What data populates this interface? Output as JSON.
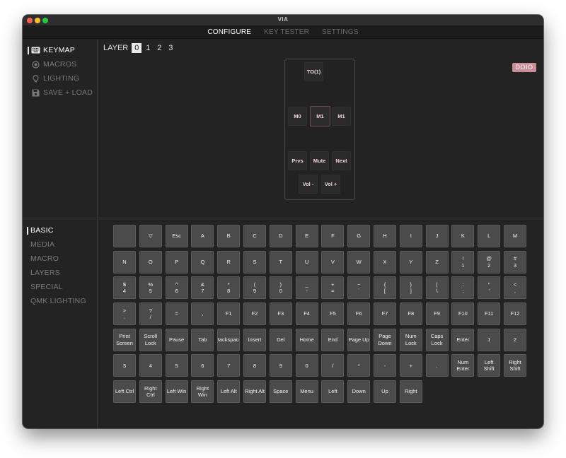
{
  "window": {
    "title": "VIA"
  },
  "topnav": {
    "tabs": [
      {
        "label": "CONFIGURE",
        "active": true
      },
      {
        "label": "KEY TESTER",
        "active": false
      },
      {
        "label": "SETTINGS",
        "active": false
      }
    ]
  },
  "sidebar_top": {
    "items": [
      {
        "label": "KEYMAP",
        "icon": "keyboard-icon",
        "active": true
      },
      {
        "label": "MACROS",
        "icon": "record-icon",
        "active": false
      },
      {
        "label": "LIGHTING",
        "icon": "lightbulb-icon",
        "active": false
      },
      {
        "label": "SAVE + LOAD",
        "icon": "floppy-disk-icon",
        "active": false
      }
    ]
  },
  "layers": {
    "label": "LAYER",
    "options": [
      "0",
      "1",
      "2",
      "3"
    ],
    "selected": "0"
  },
  "device": {
    "badge": "DOIO",
    "keys": {
      "to1": "TO(1)",
      "m0": "M0",
      "m1_center": "M1",
      "m1_right": "M1",
      "prvs": "Prvs",
      "mute": "Mute",
      "next": "Next",
      "vol_down": "Vol -",
      "vol_up": "Vol +"
    },
    "selected_key": "m1_center",
    "accent_color": "#c98d97"
  },
  "sidebar_bottom": {
    "items": [
      {
        "label": "BASIC",
        "active": true
      },
      {
        "label": "MEDIA",
        "active": false
      },
      {
        "label": "MACRO",
        "active": false
      },
      {
        "label": "LAYERS",
        "active": false
      },
      {
        "label": "SPECIAL",
        "active": false
      },
      {
        "label": "QMK LIGHTING",
        "active": false
      }
    ]
  },
  "basic_keys": [
    [
      ""
    ],
    [
      "▽"
    ],
    [
      "Esc"
    ],
    [
      "A"
    ],
    [
      "B"
    ],
    [
      "C"
    ],
    [
      "D"
    ],
    [
      "E"
    ],
    [
      "F"
    ],
    [
      "G"
    ],
    [
      "H"
    ],
    [
      "I"
    ],
    [
      "J"
    ],
    [
      "K"
    ],
    [
      "L"
    ],
    [
      "M"
    ],
    [
      "N"
    ],
    [
      "O"
    ],
    [
      "P"
    ],
    [
      "Q"
    ],
    [
      "R"
    ],
    [
      "S"
    ],
    [
      "T"
    ],
    [
      "U"
    ],
    [
      "V"
    ],
    [
      "W"
    ],
    [
      "X"
    ],
    [
      "Y"
    ],
    [
      "Z"
    ],
    [
      "!",
      "1"
    ],
    [
      "@",
      "2"
    ],
    [
      "#",
      "3"
    ],
    [
      "$",
      "4"
    ],
    [
      "%",
      "5"
    ],
    [
      "^",
      "6"
    ],
    [
      "&",
      "7"
    ],
    [
      "*",
      "8"
    ],
    [
      "(",
      "9"
    ],
    [
      ")",
      "0"
    ],
    [
      "_",
      "-"
    ],
    [
      "+",
      "="
    ],
    [
      "~",
      "`"
    ],
    [
      "{",
      "["
    ],
    [
      "}",
      "]"
    ],
    [
      "|",
      "\\"
    ],
    [
      ":",
      ";"
    ],
    [
      "\"",
      "'"
    ],
    [
      "<",
      ","
    ],
    [
      ">",
      "."
    ],
    [
      "?",
      "/"
    ],
    [
      "="
    ],
    [
      ","
    ],
    [
      "F1"
    ],
    [
      "F2"
    ],
    [
      "F3"
    ],
    [
      "F4"
    ],
    [
      "F5"
    ],
    [
      "F6"
    ],
    [
      "F7"
    ],
    [
      "F8"
    ],
    [
      "F9"
    ],
    [
      "F10"
    ],
    [
      "F11"
    ],
    [
      "F12"
    ],
    [
      "Print",
      "Screen"
    ],
    [
      "Scroll",
      "Lock"
    ],
    [
      "Pause"
    ],
    [
      "Tab"
    ],
    [
      "Backspace"
    ],
    [
      "Insert"
    ],
    [
      "Del"
    ],
    [
      "Home"
    ],
    [
      "End"
    ],
    [
      "Page Up"
    ],
    [
      "Page",
      "Down"
    ],
    [
      "Num",
      "Lock"
    ],
    [
      "Caps",
      "Lock"
    ],
    [
      "Enter"
    ],
    [
      "1"
    ],
    [
      "2"
    ],
    [
      "3"
    ],
    [
      "4"
    ],
    [
      "5"
    ],
    [
      "6"
    ],
    [
      "7"
    ],
    [
      "8"
    ],
    [
      "9"
    ],
    [
      "0"
    ],
    [
      "/"
    ],
    [
      "*"
    ],
    [
      "-"
    ],
    [
      "+"
    ],
    [
      "."
    ],
    [
      "Num",
      "Enter"
    ],
    [
      "Left",
      "Shift"
    ],
    [
      "Right",
      "Shift"
    ],
    [
      "Left Ctrl"
    ],
    [
      "Right",
      "Ctrl"
    ],
    [
      "Left Win"
    ],
    [
      "Right",
      "Win"
    ],
    [
      "Left Alt"
    ],
    [
      "Right Alt"
    ],
    [
      "Space"
    ],
    [
      "Menu"
    ],
    [
      "Left"
    ],
    [
      "Down"
    ],
    [
      "Up"
    ],
    [
      "Right"
    ]
  ]
}
